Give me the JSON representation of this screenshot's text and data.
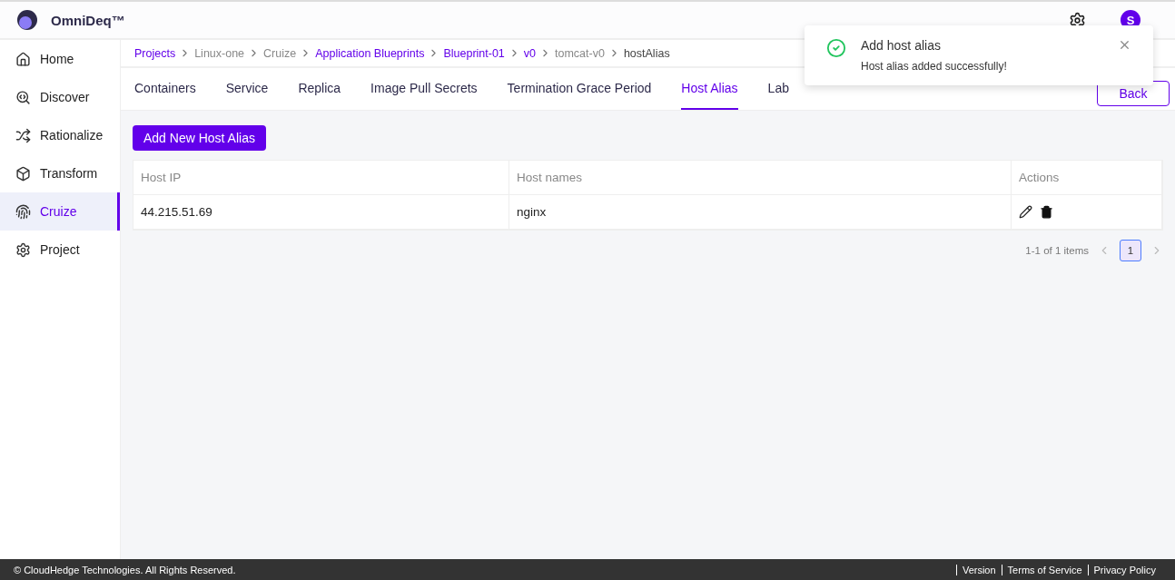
{
  "header": {
    "brand": "OmniDeq™",
    "avatar": "S"
  },
  "sidebar": {
    "items": [
      {
        "label": "Home",
        "selected": false
      },
      {
        "label": "Discover",
        "selected": false
      },
      {
        "label": "Rationalize",
        "selected": false
      },
      {
        "label": "Transform",
        "selected": false
      },
      {
        "label": "Cruize",
        "selected": true
      },
      {
        "label": "Project",
        "selected": false
      }
    ]
  },
  "breadcrumb": [
    {
      "label": "Projects",
      "kind": "link"
    },
    {
      "label": "Linux-one",
      "kind": "plain"
    },
    {
      "label": "Cruize",
      "kind": "plain"
    },
    {
      "label": "Application Blueprints",
      "kind": "link"
    },
    {
      "label": "Blueprint-01",
      "kind": "link"
    },
    {
      "label": "v0",
      "kind": "link"
    },
    {
      "label": "tomcat-v0",
      "kind": "plain"
    },
    {
      "label": "hostAlias",
      "kind": "current"
    }
  ],
  "tabs": [
    {
      "label": "Containers",
      "selected": false
    },
    {
      "label": "Service",
      "selected": false
    },
    {
      "label": "Replica",
      "selected": false
    },
    {
      "label": "Image Pull Secrets",
      "selected": false
    },
    {
      "label": "Termination Grace Period",
      "selected": false
    },
    {
      "label": "Host Alias",
      "selected": true
    },
    {
      "label": "Lab",
      "selected": false
    }
  ],
  "back_button": "Back",
  "add_button": "Add New Host Alias",
  "table": {
    "columns": [
      "Host IP",
      "Host names",
      "Actions"
    ],
    "rows": [
      {
        "host_ip": "44.215.51.69",
        "host_names": "nginx"
      }
    ]
  },
  "pagination": {
    "summary": "1-1 of 1 items",
    "pages": [
      {
        "label": "1",
        "selected": true
      }
    ]
  },
  "toast": {
    "title": "Add host alias",
    "message": "Host alias added successfully!"
  },
  "footer": {
    "copyright": "© CloudHedge Technologies. All Rights Reserved.",
    "links": [
      "Version",
      "Terms of Service",
      "Privacy Policy"
    ]
  }
}
